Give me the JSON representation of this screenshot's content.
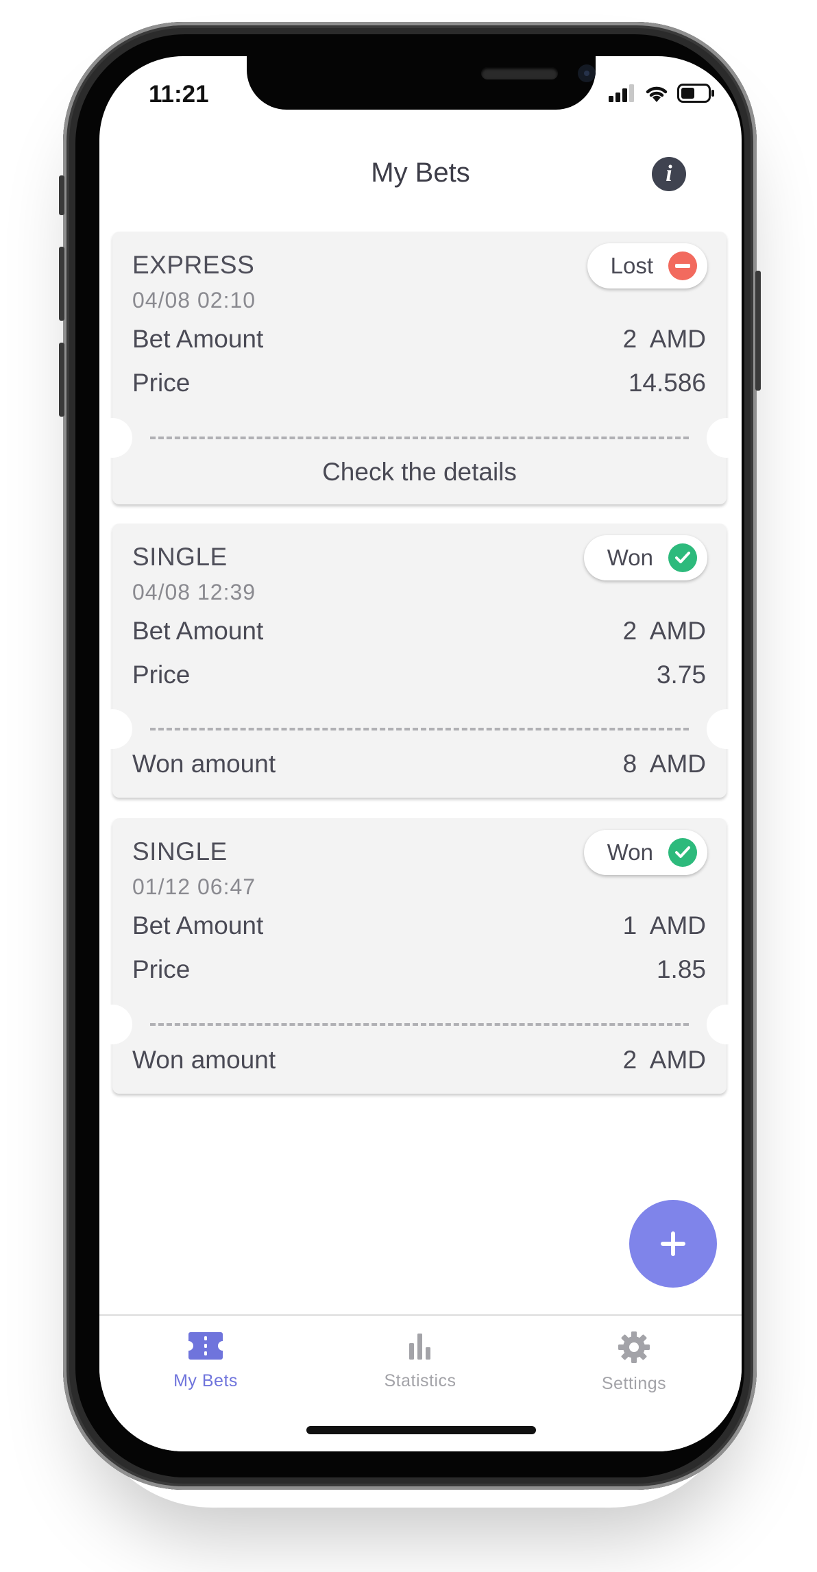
{
  "status_bar": {
    "time": "11:21"
  },
  "header": {
    "title": "My Bets",
    "info_glyph": "i"
  },
  "bets": [
    {
      "type": "EXPRESS",
      "date": "04/08 02:10",
      "status": "Lost",
      "status_color": "#f26a5e",
      "bet_amount_label": "Bet Amount",
      "bet_amount": "2  AMD",
      "price_label": "Price",
      "price": "14.586",
      "footer_link": "Check the details"
    },
    {
      "type": "SINGLE",
      "date": "04/08 12:39",
      "status": "Won",
      "status_color": "#2dba7c",
      "bet_amount_label": "Bet Amount",
      "bet_amount": "2  AMD",
      "price_label": "Price",
      "price": "3.75",
      "won_label": "Won amount",
      "won_amount": "8  AMD"
    },
    {
      "type": "SINGLE",
      "date": "01/12 06:47",
      "status": "Won",
      "status_color": "#2dba7c",
      "bet_amount_label": "Bet Amount",
      "bet_amount": "1  AMD",
      "price_label": "Price",
      "price": "1.85",
      "won_label": "Won amount",
      "won_amount": "2  AMD"
    }
  ],
  "fab": {
    "icon": "plus-icon",
    "color": "#7f84ea"
  },
  "tabs": [
    {
      "label": "My Bets",
      "icon": "ticket-icon",
      "active": true,
      "color": "#6f74dc"
    },
    {
      "label": "Statistics",
      "icon": "bar-chart-icon",
      "active": false,
      "color": "#a3a3a8"
    },
    {
      "label": "Settings",
      "icon": "gear-icon",
      "active": false,
      "color": "#a3a3a8"
    }
  ]
}
